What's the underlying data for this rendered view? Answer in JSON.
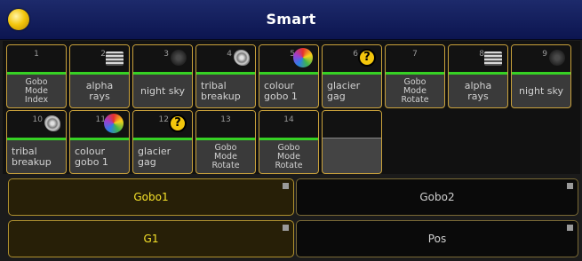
{
  "window": {
    "title": "Smart"
  },
  "pool": {
    "tiles": [
      {
        "number": "1",
        "label": "Gobo\nMode\nIndex",
        "icon": ""
      },
      {
        "number": "2",
        "label": "alpha\nrays",
        "icon": "alpha-rays-icon"
      },
      {
        "number": "3",
        "label": "night sky",
        "icon": "night-sky-icon"
      },
      {
        "number": "4",
        "label": "tribal\nbreakup",
        "icon": "tribal-breakup-icon"
      },
      {
        "number": "5",
        "label": "colour\ngobo 1",
        "icon": "colour-gobo-icon"
      },
      {
        "number": "6",
        "label": "glacier\ngag",
        "icon": "question-mark-icon"
      },
      {
        "number": "7",
        "label": "Gobo\nMode\nRotate",
        "icon": ""
      },
      {
        "number": "8",
        "label": "alpha\nrays",
        "icon": "alpha-rays-icon"
      },
      {
        "number": "9",
        "label": "night sky",
        "icon": "night-sky-icon"
      },
      {
        "number": "10",
        "label": "tribal\nbreakup",
        "icon": "tribal-breakup-icon"
      },
      {
        "number": "11",
        "label": "colour\ngobo 1",
        "icon": "colour-gobo-icon"
      },
      {
        "number": "12",
        "label": "glacier\ngag",
        "icon": "question-mark-icon"
      },
      {
        "number": "13",
        "label": "Gobo\nMode\nRotate",
        "icon": ""
      },
      {
        "number": "14",
        "label": "Gobo\nMode\nRotate",
        "icon": ""
      },
      {
        "number": "",
        "label": "",
        "icon": ""
      }
    ]
  },
  "buttons": {
    "gobo1": "Gobo1",
    "gobo2": "Gobo2",
    "g1": "G1",
    "pos": "Pos"
  },
  "colors": {
    "title_bar": "#0c1550",
    "tile_border": "#c9a13b",
    "tile_status": "#36d124",
    "active_text": "#f5e12a"
  }
}
